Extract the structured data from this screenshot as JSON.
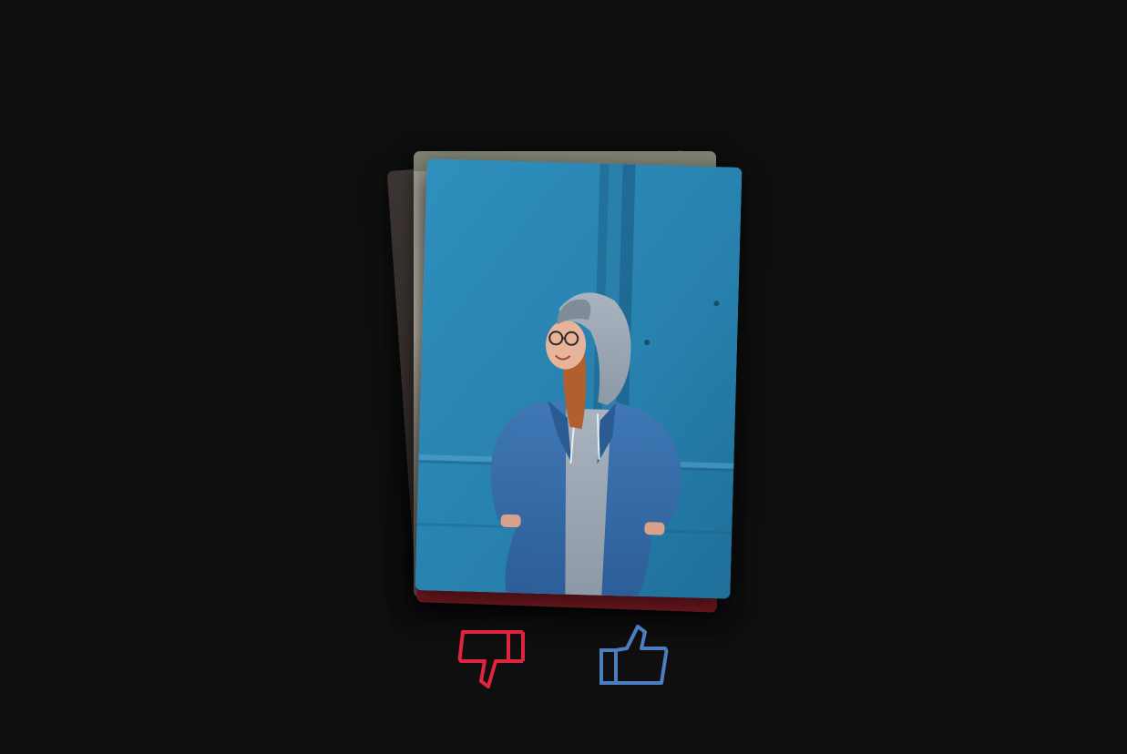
{
  "colors": {
    "background": "#0f0f10",
    "dislike": "#e0233f",
    "like": "#4a7ec0",
    "wall_blue": "#2a86b2"
  },
  "cards": {
    "front": {
      "image": "person-in-hoodie-photo"
    },
    "stack": [
      "photo-card-back-1",
      "photo-card-back-2",
      "photo-card-back-3"
    ]
  },
  "actions": {
    "dislike_icon": "thumbs-down-icon",
    "like_icon": "thumbs-up-icon"
  }
}
